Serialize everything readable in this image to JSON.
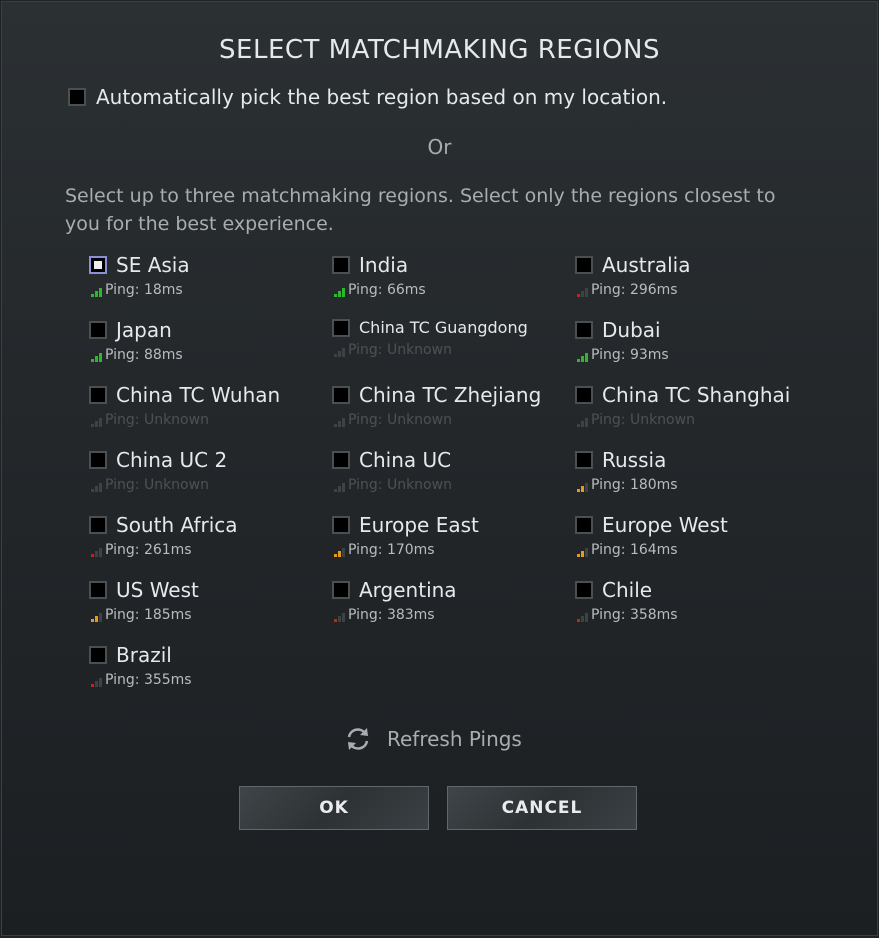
{
  "title": "SELECT MATCHMAKING REGIONS",
  "auto_label": "Automatically pick the best region based on my location.",
  "or_label": "Or",
  "instructions": "Select up to three matchmaking regions. Select only the regions closest to you for the best experience.",
  "colors": {
    "green": "#2fb62f",
    "orange": "#e59a19",
    "red": "#c3241a",
    "dim": "#3d4245"
  },
  "regions": [
    {
      "name": "SE Asia",
      "ping": "Ping: 18ms",
      "quality": "good",
      "focused": true
    },
    {
      "name": "India",
      "ping": "Ping: 66ms",
      "quality": "good"
    },
    {
      "name": "Australia",
      "ping": "Ping: 296ms",
      "quality": "bad"
    },
    {
      "name": "Japan",
      "ping": "Ping: 88ms",
      "quality": "good"
    },
    {
      "name": "China TC Guangdong",
      "ping": "Ping: Unknown",
      "quality": "unknown"
    },
    {
      "name": "Dubai",
      "ping": "Ping: 93ms",
      "quality": "good"
    },
    {
      "name": "China TC Wuhan",
      "ping": "Ping: Unknown",
      "quality": "unknown"
    },
    {
      "name": "China TC Zhejiang",
      "ping": "Ping: Unknown",
      "quality": "unknown"
    },
    {
      "name": "China TC Shanghai",
      "ping": "Ping: Unknown",
      "quality": "unknown"
    },
    {
      "name": "China UC 2",
      "ping": "Ping: Unknown",
      "quality": "unknown"
    },
    {
      "name": "China UC",
      "ping": "Ping: Unknown",
      "quality": "unknown"
    },
    {
      "name": "Russia",
      "ping": "Ping: 180ms",
      "quality": "medium"
    },
    {
      "name": "South Africa",
      "ping": "Ping: 261ms",
      "quality": "bad"
    },
    {
      "name": "Europe East",
      "ping": "Ping: 170ms",
      "quality": "medium"
    },
    {
      "name": "Europe West",
      "ping": "Ping: 164ms",
      "quality": "medium"
    },
    {
      "name": "US West",
      "ping": "Ping: 185ms",
      "quality": "medium"
    },
    {
      "name": "Argentina",
      "ping": "Ping: 383ms",
      "quality": "bad"
    },
    {
      "name": "Chile",
      "ping": "Ping: 358ms",
      "quality": "bad"
    },
    {
      "name": "Brazil",
      "ping": "Ping: 355ms",
      "quality": "bad"
    }
  ],
  "refresh_label": "Refresh Pings",
  "refresh_icon": "refresh-icon",
  "ok_label": "OK",
  "cancel_label": "CANCEL"
}
